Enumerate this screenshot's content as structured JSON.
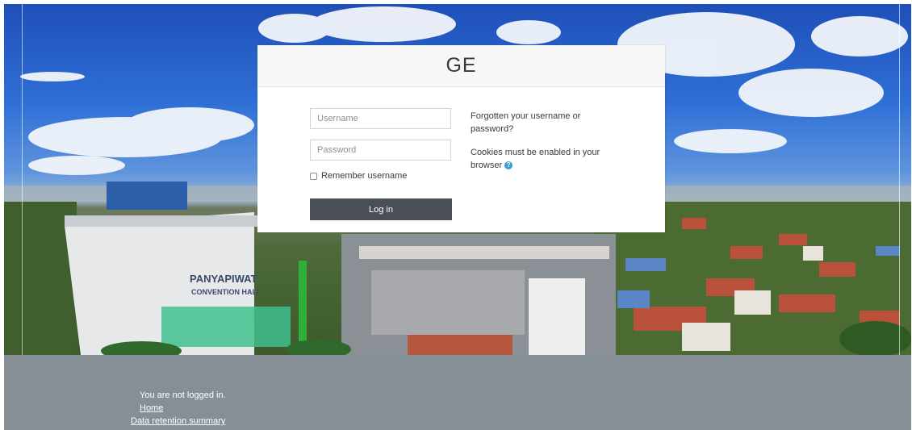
{
  "site": {
    "title": "GE"
  },
  "login": {
    "username_placeholder": "Username",
    "password_placeholder": "Password",
    "remember_label": "Remember username",
    "login_button": "Log in",
    "forgot_text": "Forgotten your username or password?",
    "cookies_text": "Cookies must be enabled in your browser",
    "help_icon": "question-circle-icon"
  },
  "footer": {
    "status": "You are not logged in.",
    "home_link": "Home",
    "retention_link": "Data retention summary"
  },
  "colors": {
    "footer_bg": "#868e96",
    "button_bg": "#4a4f57",
    "help_icon": "#3a9bd8",
    "card_header_bg": "#f7f7f7"
  }
}
